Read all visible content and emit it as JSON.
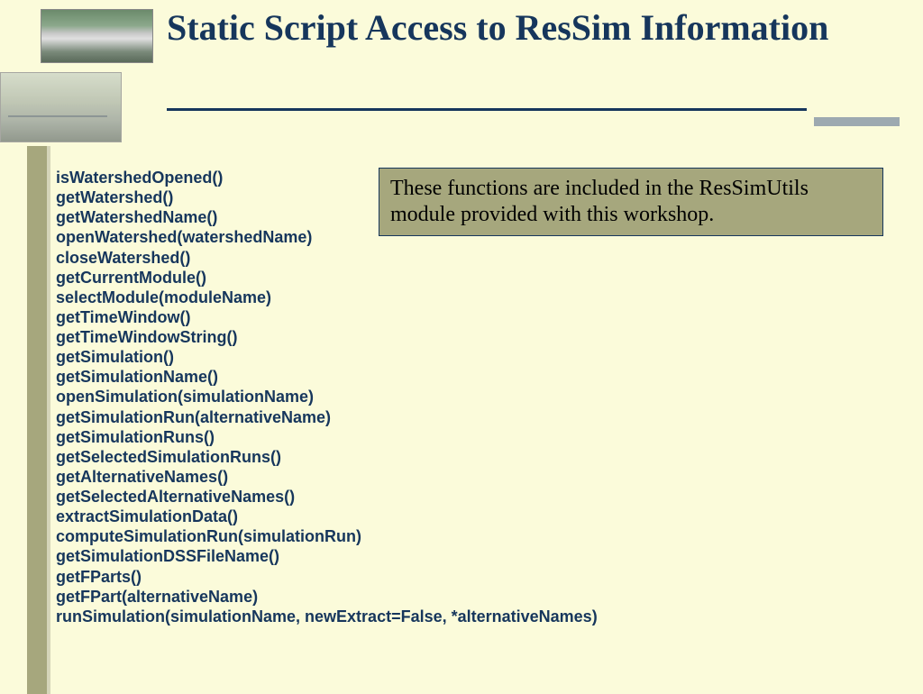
{
  "title": "Static Script Access to ResSim Information",
  "functions": [
    "isWatershedOpened()",
    "getWatershed()",
    "getWatershedName()",
    "openWatershed(watershedName)",
    "closeWatershed()",
    "getCurrentModule()",
    "selectModule(moduleName)",
    "getTimeWindow()",
    "getTimeWindowString()",
    "getSimulation()",
    "getSimulationName()",
    "openSimulation(simulationName)",
    "getSimulationRun(alternativeName)",
    "getSimulationRuns()",
    "getSelectedSimulationRuns()",
    "getAlternativeNames()",
    "getSelectedAlternativeNames()",
    "extractSimulationData()",
    "computeSimulationRun(simulationRun)",
    "getSimulationDSSFileName()",
    "getFParts()",
    "getFPart(alternativeName)",
    "runSimulation(simulationName, newExtract=False, *alternativeNames)"
  ],
  "note": "These functions are included in the ResSimUtils module provided with this workshop."
}
